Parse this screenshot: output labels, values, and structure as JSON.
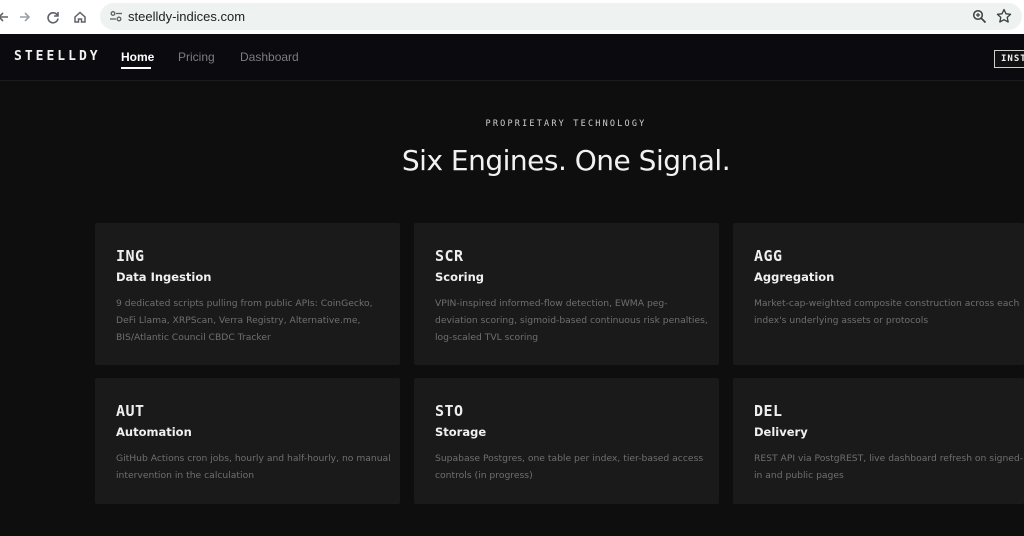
{
  "browser": {
    "url": "steelldy-indices.com",
    "icons": [
      "back-icon",
      "forward-icon",
      "reload-icon",
      "home-icon",
      "site-info-icon",
      "zoom-icon",
      "star-icon"
    ]
  },
  "header": {
    "logo": "STEELLDY",
    "nav": [
      {
        "label": "Home",
        "active": true
      },
      {
        "label": "Pricing",
        "active": false
      },
      {
        "label": "Dashboard",
        "active": false
      }
    ],
    "install_label": "INSTALL"
  },
  "hero": {
    "eyebrow": "PROPRIETARY TECHNOLOGY",
    "headline": "Six Engines. One Signal."
  },
  "cards": [
    {
      "code": "ING",
      "title": "Data Ingestion",
      "desc": "9 dedicated scripts pulling from public APIs: CoinGecko, DeFi Llama, XRPScan, Verra Registry, Alternative.me, BIS/Atlantic Council CBDC Tracker"
    },
    {
      "code": "SCR",
      "title": "Scoring",
      "desc": "VPIN-inspired informed-flow detection, EWMA peg-deviation scoring, sigmoid-based continuous risk penalties, log-scaled TVL scoring"
    },
    {
      "code": "AGG",
      "title": "Aggregation",
      "desc": "Market-cap-weighted composite construction across each index's underlying assets or protocols"
    },
    {
      "code": "AUT",
      "title": "Automation",
      "desc": "GitHub Actions cron jobs, hourly and half-hourly, no manual intervention in the calculation"
    },
    {
      "code": "STO",
      "title": "Storage",
      "desc": "Supabase Postgres, one table per index, tier-based access controls (in progress)"
    },
    {
      "code": "DEL",
      "title": "Delivery",
      "desc": "REST API via PostgREST, live dashboard refresh on signed-in and public pages"
    }
  ],
  "colors": {
    "page_bg": "#0e0e0e",
    "header_bg": "#0a0a0f",
    "card_bg": "#1a1a1a",
    "text_primary": "#f2f2f2",
    "text_muted": "#6f6f6f"
  }
}
